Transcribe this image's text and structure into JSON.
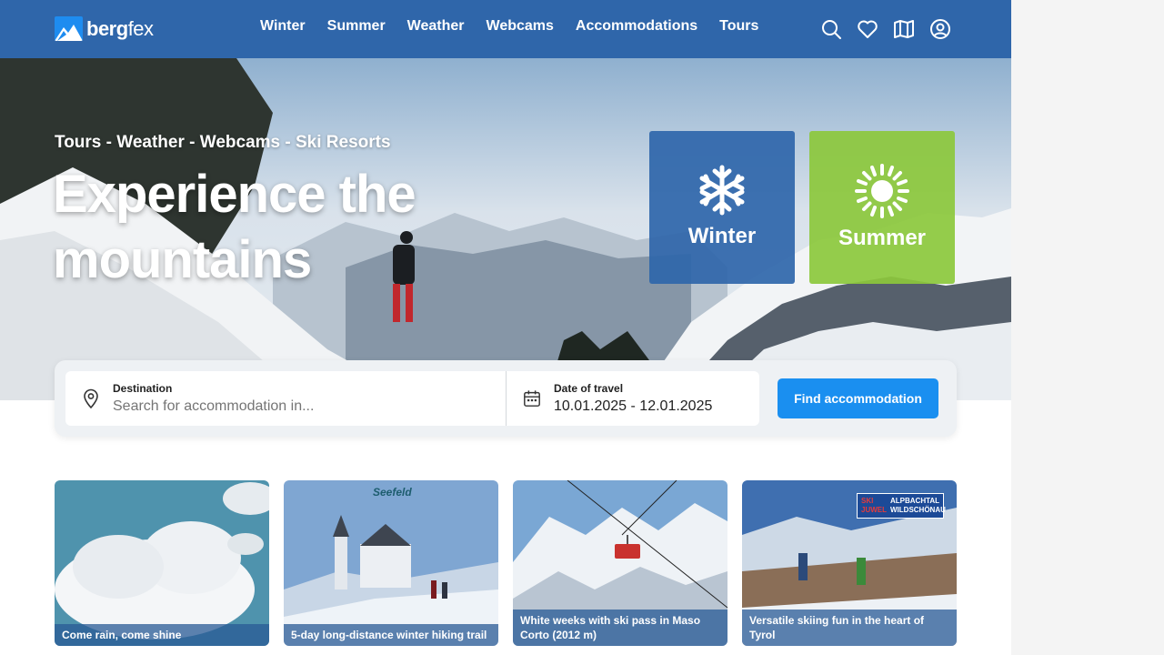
{
  "brand": {
    "name_bold": "berg",
    "name_light": "fex",
    "accent": "#2f66aa",
    "button_color": "#1a8ff0",
    "summer_color": "#8cc83c"
  },
  "nav": [
    "Winter",
    "Summer",
    "Weather",
    "Webcams",
    "Accommodations",
    "Tours"
  ],
  "header_icons": [
    "search-icon",
    "heart-icon",
    "map-icon",
    "user-icon"
  ],
  "hero": {
    "subtitle": "Tours - Weather - Webcams - Ski Resorts",
    "title": "Experience the mountains",
    "cards": [
      {
        "label": "Winter",
        "icon": "snowflake-icon"
      },
      {
        "label": "Summer",
        "icon": "sun-icon"
      }
    ]
  },
  "search": {
    "destination_label": "Destination",
    "destination_placeholder": "Search for accommodation in...",
    "date_label": "Date of travel",
    "date_value": "10.01.2025 - 12.01.2025",
    "button": "Find accommodation"
  },
  "promo_cards": [
    {
      "caption": "Come rain, come shine"
    },
    {
      "caption": "5-day long-distance winter hiking trail",
      "badge": "Seefeld"
    },
    {
      "caption": "White weeks with ski pass in Maso Corto (2012 m)"
    },
    {
      "caption": "Versatile skiing fun in the heart of Tyrol",
      "badge_a": "SKI JUWEL",
      "badge_b": "ALPBACHTAL WILDSCHÖNAU"
    }
  ]
}
